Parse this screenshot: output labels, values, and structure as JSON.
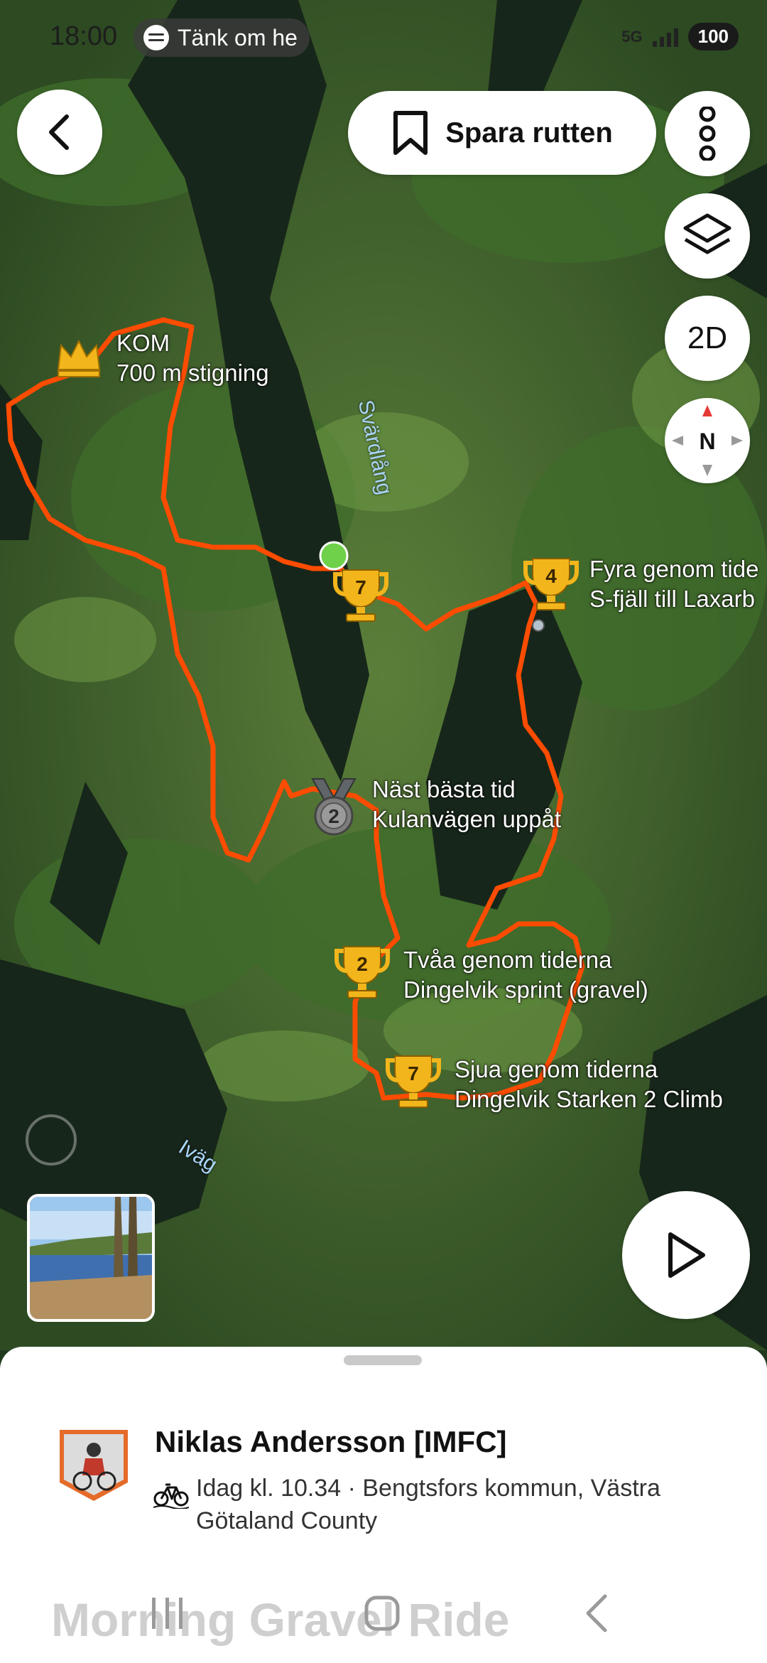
{
  "status_bar": {
    "time": "18:00",
    "media_pill": "Tänk om he",
    "network": "5G",
    "battery": "100"
  },
  "header": {
    "save_label": "Spara rutten",
    "view_mode": "2D",
    "compass": "N"
  },
  "map": {
    "water_labels": [
      "Svärdlång",
      "Iväg"
    ],
    "segments": [
      {
        "icon": "crown-icon",
        "title": "KOM",
        "subtitle": "700 m stigning"
      },
      {
        "icon": "trophy-icon",
        "rank": "7",
        "title": "",
        "subtitle": ""
      },
      {
        "icon": "trophy-icon",
        "rank": "4",
        "title": "Fyra genom tide",
        "subtitle": "S-fjäll till Laxarb"
      },
      {
        "icon": "medal-icon",
        "rank": "2",
        "title": "Näst bästa tid",
        "subtitle": "Kulanvägen uppåt"
      },
      {
        "icon": "trophy-icon",
        "rank": "2",
        "title": "Tvåa genom tiderna",
        "subtitle": "Dingelvik sprint (gravel)"
      },
      {
        "icon": "trophy-icon",
        "rank": "7",
        "title": "Sjua genom tiderna",
        "subtitle": "Dingelvik Starken 2 Climb"
      }
    ]
  },
  "activity": {
    "athlete": "Niklas Andersson [IMFC]",
    "meta": "Idag kl. 10.34 · Bengtsfors kommun, Västra Götaland County",
    "title": "Morning Gravel Ride"
  },
  "colors": {
    "route": "#fc4c02",
    "trophy": "#f2b51b",
    "medal": "#7d7d7d",
    "start": "#6fd14a"
  }
}
